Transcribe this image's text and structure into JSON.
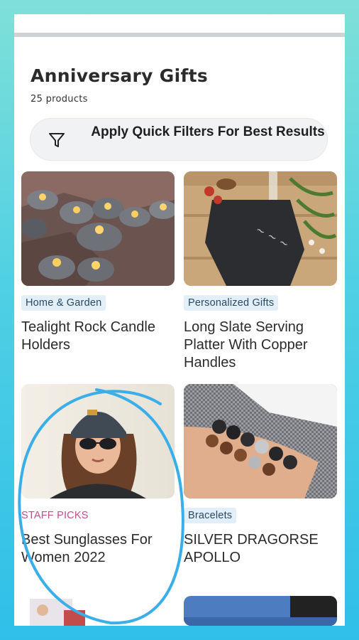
{
  "page": {
    "title": "Anniversary Gifts",
    "count": "25 products",
    "filter_label": "Apply Quick Filters For Best Results"
  },
  "products": [
    {
      "category": "Home & Garden",
      "title": "Tealight Rock Candle Holders",
      "image": "tealight-rocks"
    },
    {
      "category": "Personalized Gifts",
      "title": "Long Slate Serving Platter With Copper Handles",
      "image": "slate-platter"
    },
    {
      "category": "STAFF PICKS",
      "title": "Best Sunglasses For Women 2022",
      "image": "woman-sunglasses"
    },
    {
      "category": "Bracelets",
      "title": "SILVER DRAGORSE APOLLO",
      "image": "bead-bracelet"
    }
  ],
  "annotation": {
    "shape": "circle-highlight",
    "color": "#3aaee8"
  },
  "colors": {
    "background": "#4fd0e4",
    "accent_pink": "#c24d8e",
    "badge_bg": "#e2eef8"
  }
}
